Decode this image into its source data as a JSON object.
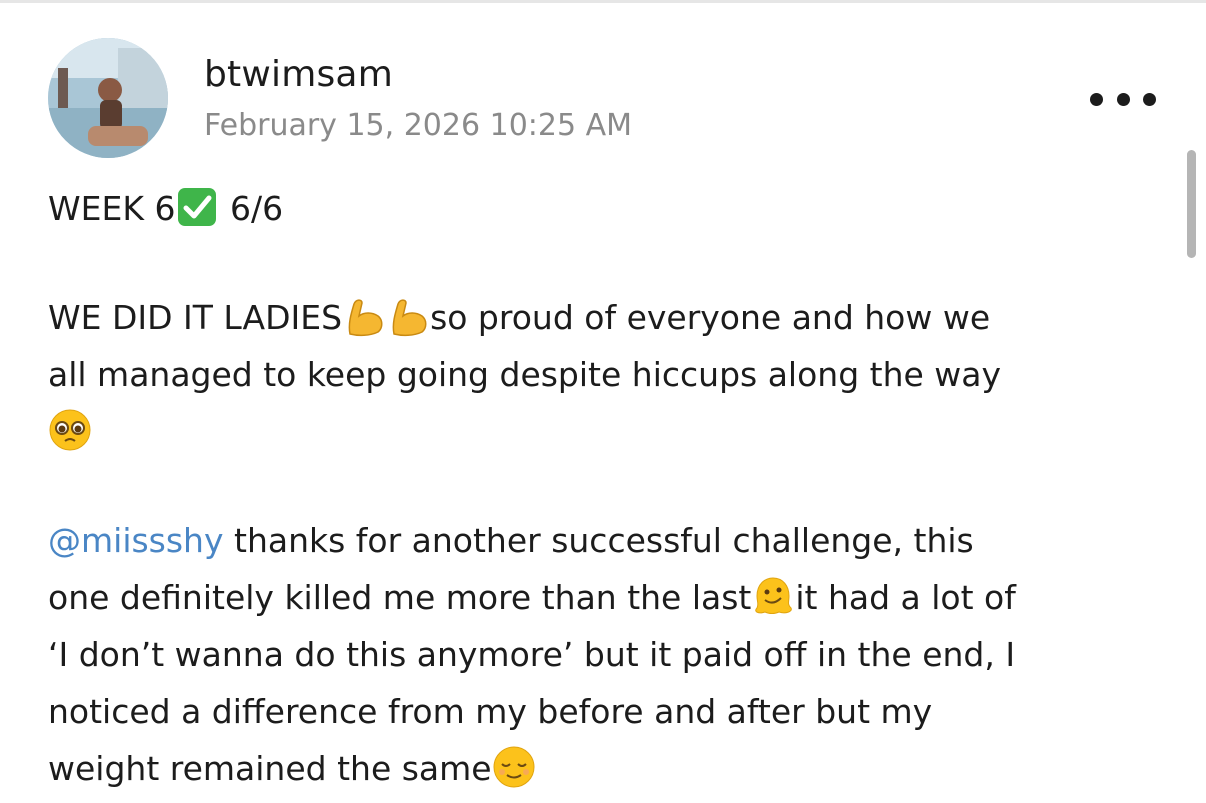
{
  "post": {
    "username": "btwimsam",
    "timestamp": "February 15, 2026 10:25 AM",
    "line1": {
      "a": "WEEK 6",
      "b": " 6/6"
    },
    "para2": {
      "l1a": "WE DID IT LADIES",
      "l1b": "so proud of everyone and how we",
      "l2": "all managed to keep going despite hiccups along the way"
    },
    "para3": {
      "mention": "@miissshy",
      "l1": " thanks for another successful challenge, this",
      "l2a": "one definitely killed me more than the last",
      "l2b": "it had a lot of",
      "l3": "‘I don’t wanna do this anymore’ but it paid off in the end, I",
      "l4": "noticed a difference from my before and after but my",
      "l5": "weight remained the same"
    }
  },
  "icons": {
    "more": "more-options-icon",
    "check": "check-mark-button-emoji",
    "muscle": "flexed-biceps-emoji",
    "pleading": "pleading-face-emoji",
    "melting": "melting-face-emoji",
    "relieved": "relieved-face-emoji"
  },
  "colors": {
    "mention": "#4a86c5",
    "timestamp": "#8a8a8a",
    "text": "#1c1c1c"
  }
}
